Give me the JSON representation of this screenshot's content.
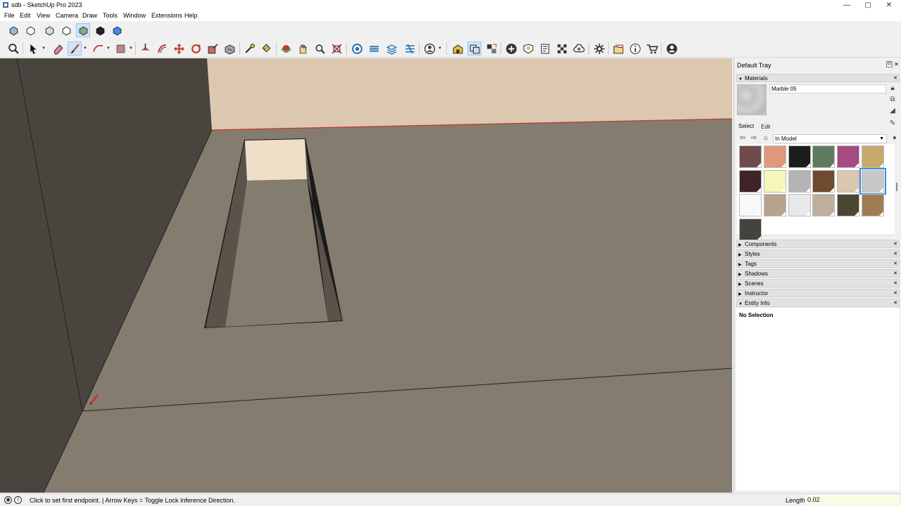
{
  "window": {
    "title": "sdb - SketchUp Pro 2023",
    "controls": {
      "minimize": "—",
      "maximize": "▢",
      "close": "✕"
    }
  },
  "menu": [
    "File",
    "Edit",
    "View",
    "Camera",
    "Draw",
    "Tools",
    "Window",
    "Extensions",
    "Help"
  ],
  "toolbar_views": [
    "iso-view-icon",
    "top-view-icon",
    "front-view-icon",
    "right-view-icon",
    "back-view-icon",
    "left-view-icon",
    "bottom-view-icon"
  ],
  "toolbar_main": [
    "zoom-icon",
    "select-icon",
    "eraser-icon",
    "line-icon",
    "arc-icon",
    "rectangle-icon",
    "push-pull-icon",
    "offset-icon",
    "move-icon",
    "rotate-icon",
    "scale-icon",
    "follow-me-icon",
    "tape-measure-icon",
    "paint-bucket-icon",
    "orbit-icon",
    "pan-icon",
    "zoom-window-icon",
    "zoom-extents-icon",
    "section-plane-icon",
    "layers-icon",
    "outliner-icon",
    "sandbox-icon",
    "user-icon",
    "warehouse-icon",
    "extension-icon",
    "layout-icon",
    "add-icon",
    "tag-icon",
    "report-icon",
    "pattern-icon",
    "cloud-icon",
    "settings-icon",
    "folder-icon",
    "info-icon",
    "cart-icon",
    "account-icon"
  ],
  "tray": {
    "title": "Default Tray",
    "materials": {
      "header": "Materials",
      "current_name": "Marble 05",
      "tab_select": "Select",
      "tab_edit": "Edit",
      "collection": "In Model",
      "swatches": [
        {
          "color": "#6e4a4a",
          "selected": false
        },
        {
          "color": "#e0977a",
          "selected": false
        },
        {
          "color": "#1c1c1c",
          "selected": false
        },
        {
          "color": "#5f7a5c",
          "selected": false
        },
        {
          "color": "#a54a82",
          "selected": false
        },
        {
          "color": "#c9a86b",
          "selected": false
        },
        {
          "color": "#3e2426",
          "selected": false
        },
        {
          "color": "#f5f7b8",
          "selected": false
        },
        {
          "color": "#b4b4b4",
          "selected": false
        },
        {
          "color": "#6f4a2e",
          "selected": false
        },
        {
          "color": "#d9c7b0",
          "selected": false
        },
        {
          "color": "#c8c8c8",
          "selected": true
        },
        {
          "color": "#f8f8f8",
          "selected": false
        },
        {
          "color": "#b9a28e",
          "selected": false
        },
        {
          "color": "#e8e8e8",
          "selected": false
        },
        {
          "color": "#bfae9c",
          "selected": false
        },
        {
          "color": "#4b4533",
          "selected": false
        },
        {
          "color": "#a07c55",
          "selected": false
        },
        {
          "color": "#45433d",
          "selected": false
        }
      ]
    },
    "panels": [
      "Components",
      "Styles",
      "Tags",
      "Shadows",
      "Scenes",
      "Instructor",
      "Entity Info"
    ],
    "entity_info": "No Selection"
  },
  "status": {
    "message": "Click to set first endpoint. | Arrow Keys = Toggle Lock Inference Direction.",
    "vcb_label": "Length",
    "vcb_value": "0.02"
  },
  "colors": {
    "floor": "#857c70",
    "wall_dark": "#4a443f",
    "wall_back": "#dcc7b1",
    "opening_face": "#f0dfc8",
    "trench_side": "#5b5349"
  }
}
